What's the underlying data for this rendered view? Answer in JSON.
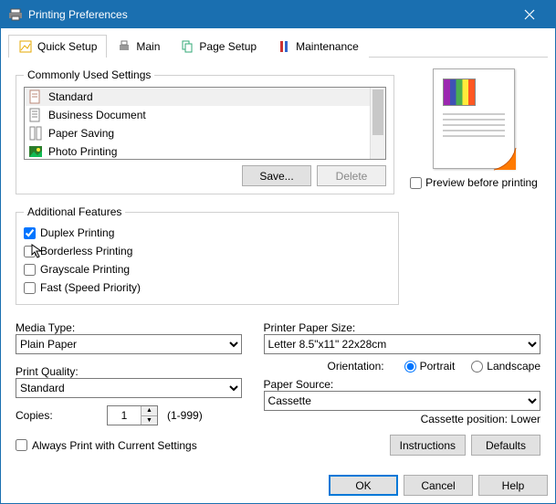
{
  "window": {
    "title": "Printing Preferences"
  },
  "tabs": {
    "quick_setup": "Quick Setup",
    "main": "Main",
    "page_setup": "Page Setup",
    "maintenance": "Maintenance"
  },
  "common_settings": {
    "legend": "Commonly Used Settings",
    "items": [
      {
        "label": "Standard"
      },
      {
        "label": "Business Document"
      },
      {
        "label": "Paper Saving"
      },
      {
        "label": "Photo Printing"
      }
    ],
    "save": "Save...",
    "delete": "Delete"
  },
  "preview": {
    "checkbox_label": "Preview before printing"
  },
  "features": {
    "legend": "Additional Features",
    "duplex": "Duplex Printing",
    "borderless": "Borderless Printing",
    "grayscale": "Grayscale Printing",
    "fast": "Fast (Speed Priority)"
  },
  "media": {
    "label": "Media Type:",
    "value": "Plain Paper"
  },
  "quality": {
    "label": "Print Quality:",
    "value": "Standard"
  },
  "paper_size": {
    "label": "Printer Paper Size:",
    "value": "Letter 8.5\"x11\" 22x28cm"
  },
  "orientation": {
    "label": "Orientation:",
    "portrait": "Portrait",
    "landscape": "Landscape"
  },
  "paper_source": {
    "label": "Paper Source:",
    "value": "Cassette",
    "position": "Cassette position: Lower"
  },
  "copies": {
    "label": "Copies:",
    "value": "1",
    "range": "(1-999)"
  },
  "always_current": "Always Print with Current Settings",
  "buttons": {
    "instructions": "Instructions",
    "defaults": "Defaults",
    "ok": "OK",
    "cancel": "Cancel",
    "help": "Help"
  }
}
